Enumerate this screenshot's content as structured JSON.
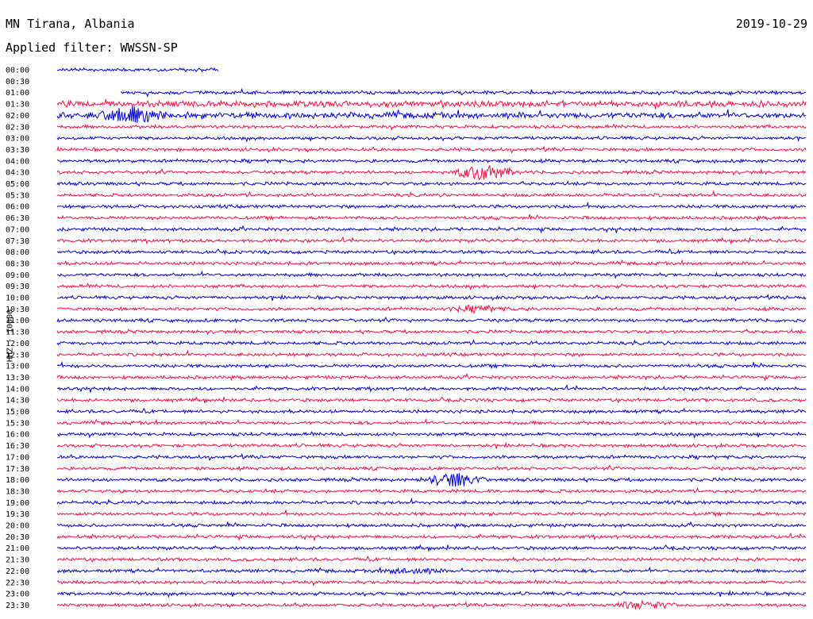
{
  "header": {
    "station": "MN Tirana, Albania",
    "date": "2019-10-29",
    "filter": "Applied filter: WWSSN-SP"
  },
  "chart_data": {
    "type": "line",
    "title": "MN Tirana, Albania",
    "date": "2019-10-29",
    "filter": "Applied filter: WWSSN-SP",
    "ylabel": "HHZ - 10000",
    "row_labels": [
      "00:00",
      "00:30",
      "01:00",
      "01:30",
      "02:00",
      "02:30",
      "03:00",
      "03:30",
      "04:00",
      "04:30",
      "05:00",
      "05:30",
      "06:00",
      "06:30",
      "07:00",
      "07:30",
      "08:00",
      "08:30",
      "09:00",
      "09:30",
      "10:00",
      "10:30",
      "11:00",
      "11:30",
      "12:00",
      "12:30",
      "13:00",
      "13:30",
      "14:00",
      "14:30",
      "15:00",
      "15:30",
      "16:00",
      "16:30",
      "17:00",
      "17:30",
      "18:00",
      "18:30",
      "19:00",
      "19:30",
      "20:00",
      "20:30",
      "21:00",
      "21:30",
      "22:00",
      "22:30",
      "23:00",
      "23:30"
    ],
    "row_colors": [
      "#0000cc",
      "#ee1144"
    ],
    "row_duration_minutes": 30,
    "data_coverage": [
      {
        "row": "00:00",
        "start_fraction": 0.0,
        "end_fraction": 0.215
      },
      {
        "row": "00:30",
        "start_fraction": 0.0,
        "end_fraction": 0.0
      },
      {
        "row": "01:00",
        "start_fraction": 0.085,
        "end_fraction": 1.0
      }
    ],
    "notable_events": [
      {
        "row": "04:30",
        "position_fraction": 0.57,
        "relative_amplitude": 6
      },
      {
        "row": "18:00",
        "position_fraction": 0.53,
        "relative_amplitude": 5
      },
      {
        "row": "02:00",
        "position_fraction": 0.1,
        "relative_amplitude": 3
      },
      {
        "row": "10:30",
        "position_fraction": 0.56,
        "relative_amplitude": 2
      },
      {
        "row": "22:00",
        "position_fraction": 0.47,
        "relative_amplitude": 2
      },
      {
        "row": "23:30",
        "position_fraction": 0.78,
        "relative_amplitude": 3
      }
    ]
  }
}
